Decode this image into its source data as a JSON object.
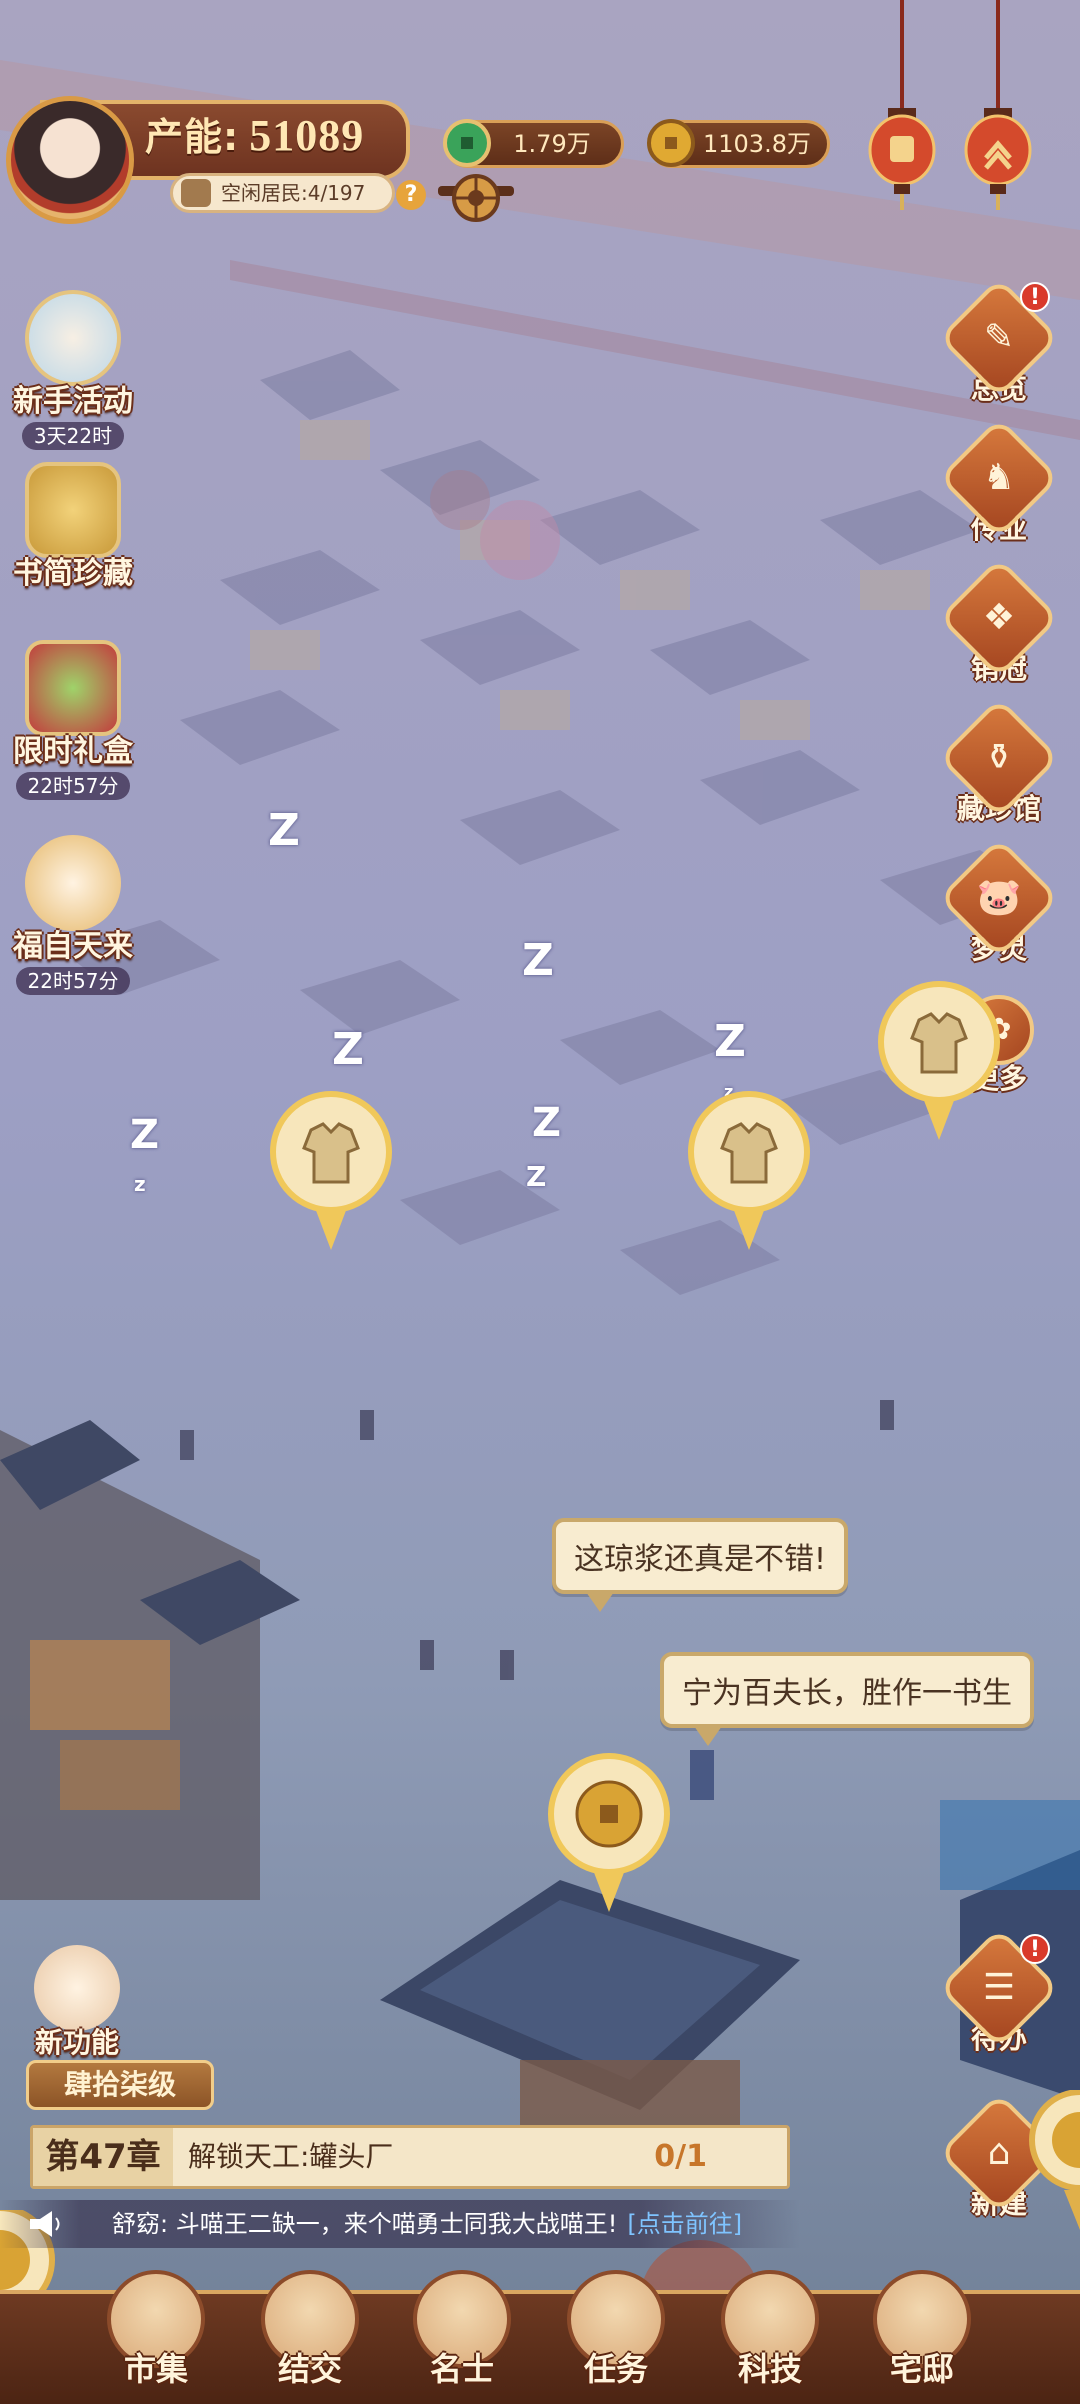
{
  "hud": {
    "production_label": "产能:",
    "production_value": "51089",
    "idle_residents": "空闲居民:4/197",
    "help_glyph": "?",
    "jade_amount": "1.79万",
    "coin_amount": "1103.8万"
  },
  "left_menu": {
    "newbie": {
      "label": "新手活动",
      "timer": "3天22时"
    },
    "bamboo": {
      "label": "书简珍藏"
    },
    "giftbox": {
      "label": "限时礼盒",
      "timer": "22时57分"
    },
    "fortune": {
      "label": "福自天来",
      "timer": "22时57分"
    },
    "new_feature": {
      "label": "新功能"
    }
  },
  "right_menu": {
    "overview": {
      "label": "总览",
      "badge": "!"
    },
    "career": {
      "label": "传业"
    },
    "sales": {
      "label": "销冠"
    },
    "museum": {
      "label": "藏珍馆"
    },
    "spirit": {
      "label": "梦灵"
    },
    "more": {
      "label": "更多"
    },
    "todo": {
      "label": "待办",
      "badge": "!"
    },
    "build": {
      "label": "新建"
    }
  },
  "map": {
    "sleep_z": "Z",
    "sleep_z_small": "z",
    "speech1": "这琼浆还真是不错!",
    "speech2": "宁为百夫长，胜作一书生"
  },
  "quest": {
    "level": "肆拾柒级",
    "chapter": "第47章",
    "task": "解锁天工:罐头厂",
    "progress": "0/1"
  },
  "notice": {
    "message": "舒窈: 斗喵王二缺一，来个喵勇士同我大战喵王!",
    "link": "[点击前往]"
  },
  "nav": {
    "market": "市集",
    "friends": "结交",
    "celebrity": "名士",
    "tasks": "任务",
    "tech": "科技",
    "mansion": "宅邸"
  },
  "colors": {
    "fog": "#9ea0c2",
    "panel_brown": "#6e3320",
    "gold_border": "#e3b36a",
    "parchment": "#f4e6c8"
  }
}
